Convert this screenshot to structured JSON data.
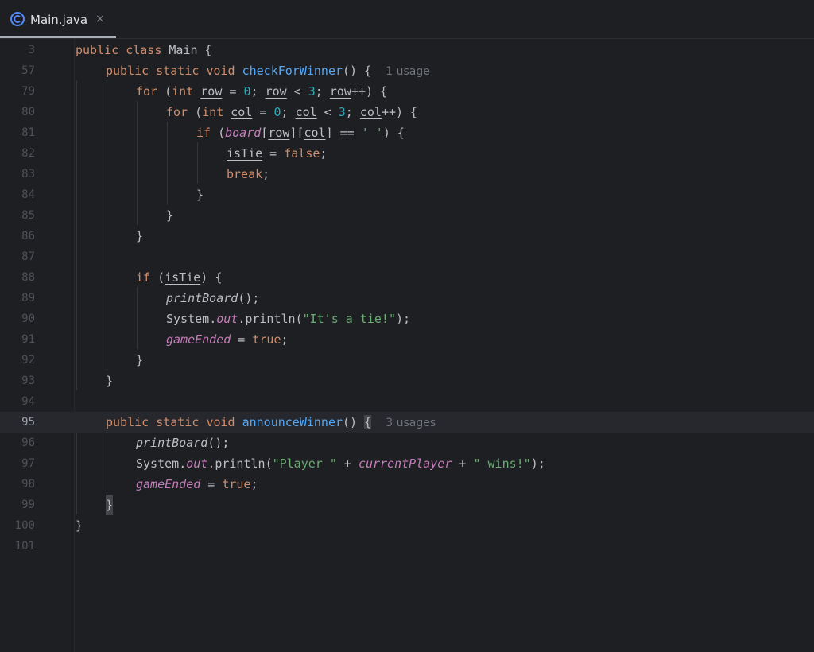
{
  "tab": {
    "file_name": "Main.java",
    "close_glyph": "×",
    "icon": "java-class-icon"
  },
  "editor": {
    "current_line": "95",
    "lines": [
      {
        "n": "3",
        "text": "public class Main {"
      },
      {
        "n": "57",
        "text": "public static void checkForWinner() {",
        "hint": "1 usage"
      },
      {
        "n": "79",
        "text": "for (int row = 0; row < 3; row++) {"
      },
      {
        "n": "80",
        "text": "for (int col = 0; col < 3; col++) {"
      },
      {
        "n": "81",
        "text": "if (board[row][col] == ' ') {"
      },
      {
        "n": "82",
        "text": "isTie = false;"
      },
      {
        "n": "83",
        "text": "break;"
      },
      {
        "n": "84",
        "text": "}"
      },
      {
        "n": "85",
        "text": "}"
      },
      {
        "n": "86",
        "text": "}"
      },
      {
        "n": "87",
        "text": ""
      },
      {
        "n": "88",
        "text": "if (isTie) {"
      },
      {
        "n": "89",
        "text": "printBoard();"
      },
      {
        "n": "90",
        "text": "System.out.println(\"It's a tie!\");"
      },
      {
        "n": "91",
        "text": "gameEnded = true;"
      },
      {
        "n": "92",
        "text": "}"
      },
      {
        "n": "93",
        "text": "}"
      },
      {
        "n": "94",
        "text": ""
      },
      {
        "n": "95",
        "text": "public static void announceWinner() {",
        "hint": "3 usages"
      },
      {
        "n": "96",
        "text": "printBoard();"
      },
      {
        "n": "97",
        "text": "System.out.println(\"Player \" + currentPlayer + \" wins!\");"
      },
      {
        "n": "98",
        "text": "gameEnded = true;"
      },
      {
        "n": "99",
        "text": "}"
      },
      {
        "n": "100",
        "text": "}"
      },
      {
        "n": "101",
        "text": ""
      }
    ],
    "tokens": {
      "public": "public",
      "class": "class",
      "static": "static",
      "void": "void",
      "for": "for",
      "int": "int",
      "if": "if",
      "false": "false",
      "true": "true",
      "break": "break",
      "main": "Main",
      "check_for_winner": "checkForWinner",
      "announce_winner": "announceWinner",
      "row": "row",
      "col": "col",
      "zero": "0",
      "three": "3",
      "board": "board",
      "is_tie": "isTie",
      "print_board": "printBoard",
      "system": "System",
      "out": "out",
      "println": "println",
      "str_tie": "\"It's a tie!\"",
      "str_player": "\"Player \"",
      "str_wins": "\" wins!\"",
      "str_space": "' '",
      "game_ended": "gameEnded",
      "current_player": "currentPlayer",
      "usage_1": "1 usage",
      "usage_3": "3 usages"
    }
  }
}
